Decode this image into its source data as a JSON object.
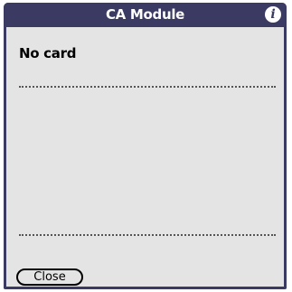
{
  "dialog": {
    "title": "CA Module",
    "info_icon": "info-icon"
  },
  "main": {
    "status": "No card"
  },
  "buttons": {
    "close_label": "Close"
  },
  "colors": {
    "titlebar": "#3a3a62",
    "background": "#e4e4e4"
  }
}
